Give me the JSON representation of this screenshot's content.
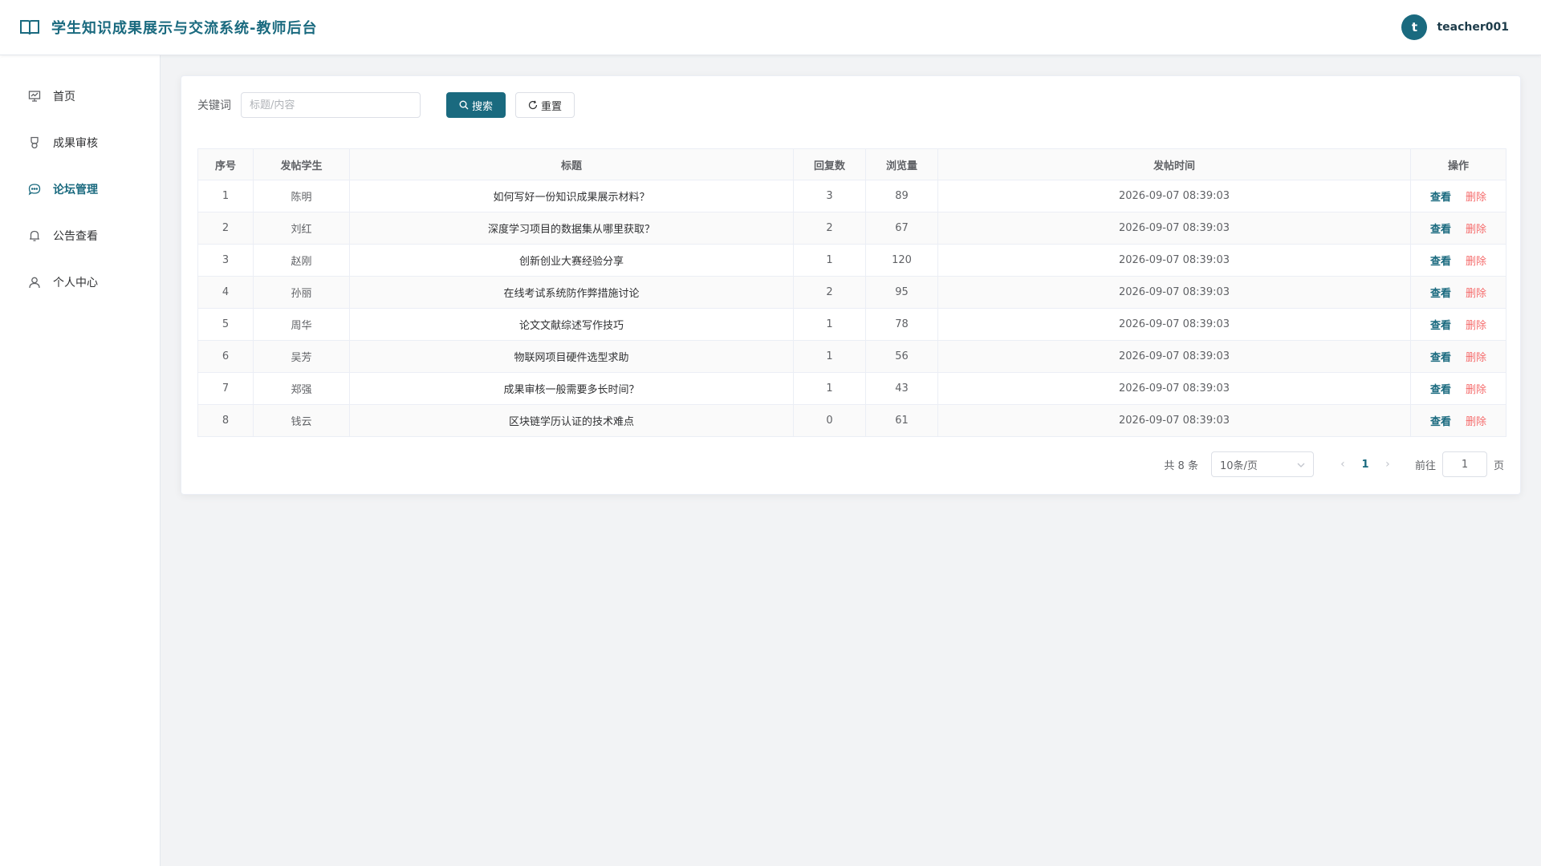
{
  "header": {
    "app_title": "学生知识成果展示与交流系统-教师后台",
    "book_icon": "book-open-icon",
    "user": {
      "avatar_letter": "t",
      "name": "teacher001"
    }
  },
  "colors": {
    "accent": "#1a6a7f",
    "danger": "#f56c6c",
    "background": "#f2f3f5"
  },
  "sidebar": {
    "items": [
      {
        "label": "首页",
        "icon": "presentation-chart-icon",
        "active": false
      },
      {
        "label": "成果审核",
        "icon": "medal-icon",
        "active": false
      },
      {
        "label": "论坛管理",
        "icon": "chat-bubble-icon",
        "active": true
      },
      {
        "label": "公告查看",
        "icon": "bell-icon",
        "active": false
      },
      {
        "label": "个人中心",
        "icon": "user-icon",
        "active": false
      }
    ]
  },
  "search": {
    "label": "关键词",
    "placeholder": "标题/内容",
    "value": "",
    "search_button": "搜索",
    "reset_button": "重置"
  },
  "table": {
    "headers": [
      "序号",
      "发帖学生",
      "标题",
      "回复数",
      "浏览量",
      "发帖时间",
      "操作"
    ],
    "view_label": "查看",
    "delete_label": "删除",
    "rows": [
      {
        "index": "1",
        "student": "陈明",
        "title": "如何写好一份知识成果展示材料？",
        "replies": "3",
        "views": "89",
        "time": "2026-09-07 08:39:03"
      },
      {
        "index": "2",
        "student": "刘红",
        "title": "深度学习项目的数据集从哪里获取？",
        "replies": "2",
        "views": "67",
        "time": "2026-09-07 08:39:03"
      },
      {
        "index": "3",
        "student": "赵刚",
        "title": "创新创业大赛经验分享",
        "replies": "1",
        "views": "120",
        "time": "2026-09-07 08:39:03"
      },
      {
        "index": "4",
        "student": "孙丽",
        "title": "在线考试系统防作弊措施讨论",
        "replies": "2",
        "views": "95",
        "time": "2026-09-07 08:39:03"
      },
      {
        "index": "5",
        "student": "周华",
        "title": "论文文献综述写作技巧",
        "replies": "1",
        "views": "78",
        "time": "2026-09-07 08:39:03"
      },
      {
        "index": "6",
        "student": "吴芳",
        "title": "物联网项目硬件选型求助",
        "replies": "1",
        "views": "56",
        "time": "2026-09-07 08:39:03"
      },
      {
        "index": "7",
        "student": "郑强",
        "title": "成果审核一般需要多长时间？",
        "replies": "1",
        "views": "43",
        "time": "2026-09-07 08:39:03"
      },
      {
        "index": "8",
        "student": "钱云",
        "title": "区块链学历认证的技术难点",
        "replies": "0",
        "views": "61",
        "time": "2026-09-07 08:39:03"
      }
    ]
  },
  "pagination": {
    "total_text": "共 8 条",
    "page_size": "10条/页",
    "current_page": "1",
    "goto_label": "前往",
    "goto_value": "1",
    "page_unit": "页"
  }
}
